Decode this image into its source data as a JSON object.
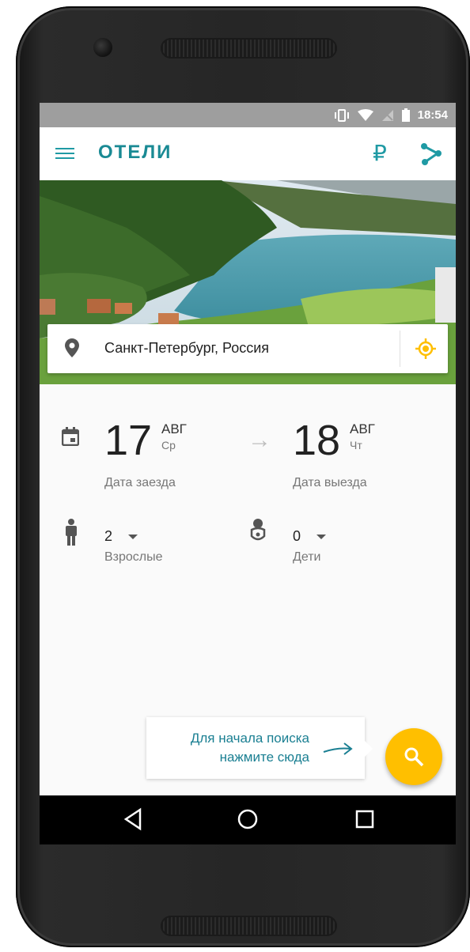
{
  "status_bar": {
    "time": "18:54",
    "icons": [
      "vibrate-icon",
      "wifi-icon",
      "signal-off-icon",
      "battery-icon"
    ]
  },
  "app_bar": {
    "title": "ОТЕЛИ",
    "currency_symbol": "₽",
    "icons": [
      "menu-icon",
      "ruble-icon",
      "share-icon"
    ]
  },
  "search": {
    "city": "Санкт-Петербург, Россия",
    "icons": [
      "location-pin-icon",
      "my-location-icon"
    ]
  },
  "checkin": {
    "day": "17",
    "month": "АВГ",
    "weekday": "Ср",
    "label": "Дата заезда"
  },
  "checkout": {
    "day": "18",
    "month": "АВГ",
    "weekday": "Чт",
    "label": "Дата выезда"
  },
  "adults": {
    "count": "2",
    "label": "Взрослые"
  },
  "children": {
    "count": "0",
    "label": "Дети"
  },
  "hint": {
    "line1": "Для начала поиска",
    "line2": "нажмите сюда"
  },
  "colors": {
    "accent": "#1f9aa4",
    "fab": "#ffbf00",
    "status_bar": "#9e9e9e"
  },
  "nav_bar": {
    "icons": [
      "back-icon",
      "home-icon",
      "recents-icon"
    ]
  }
}
